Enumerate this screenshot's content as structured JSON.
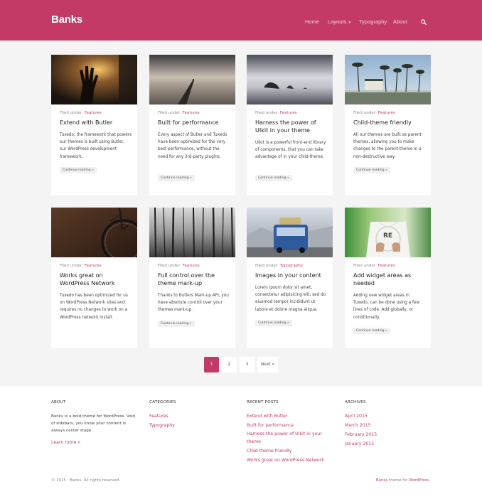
{
  "header": {
    "logo": "Banks",
    "nav": {
      "home": "Home",
      "layouts": "Layouts",
      "typography": "Typography",
      "about": "About"
    },
    "search_icon": "search-icon"
  },
  "colors": {
    "brand": "#c23a65",
    "page_bg": "#f4f4f4"
  },
  "filed_label": "Filed under:",
  "continue_label": "Continue reading »",
  "posts": [
    {
      "category": "Features",
      "title": "Extend with Butler",
      "excerpt": "Tuxedo, the framework that powers our themes is built using Butler, our WordPress development framework."
    },
    {
      "category": "Features",
      "title": "Built for performance",
      "excerpt": "Every aspect of Butler and Tuxedo have been optimized for the very best performance, without the need for any 3rd-party plugins."
    },
    {
      "category": "Features",
      "title": "Harness the power of UIkit in your theme",
      "excerpt": "UIkit is a powerful front-end library of components, that you can take advantage of in your child-theme."
    },
    {
      "category": "Features",
      "title": "Child-theme friendly",
      "excerpt": "All our themes are built as parent-themes, allowing you to make changes to the parent-theme in a non-destructive way."
    },
    {
      "category": "Features",
      "title": "Works great on WordPress Network",
      "excerpt": "Tuxedo has been optimized for us on WordPress Network sites and requires no changes to work on a WordPress network install."
    },
    {
      "category": "Features",
      "title": "Full control over the theme mark-up",
      "excerpt": "Thanks to Butlers Mark-up API, you have absolute control over your themes mark-up."
    },
    {
      "category": "Typography",
      "title": "Images in your content",
      "excerpt": "Lorem ipsum dolor sit amet, consectetur adipisicing elit, sed do eiusmod tempor incididunt ut labore et dolore magna aliqua."
    },
    {
      "category": "Features",
      "title": "Add widget areas as needed",
      "excerpt": "Adding new widget areas in Tuxedo, can be done using a few lines of code. Add globally, or conditionally."
    }
  ],
  "pagination": {
    "current": "1",
    "pages": [
      "1",
      "2",
      "3"
    ],
    "next": "Next »"
  },
  "footer": {
    "about": {
      "heading": "ABOUT",
      "text": "Banks is a bold theme for WordPress. Void of sidebars, you know your content is always center stage.",
      "link": "Learn more »"
    },
    "categories": {
      "heading": "CATEGORIES",
      "items": [
        "Features",
        "Typography"
      ]
    },
    "recent": {
      "heading": "RECENT POSTS",
      "items": [
        "Extend with Butler",
        "Built for performance",
        "Harness the power of UIkit in your theme",
        "Child-theme friendly",
        "Works great on WordPress Network"
      ]
    },
    "archives": {
      "heading": "ARCHIVES",
      "items": [
        "April 2015",
        "March 2015",
        "February 2015",
        "January 2015"
      ]
    },
    "copyright": "© 2015 - Banks. All rights reserved.",
    "credit": {
      "theme": "Banks",
      "mid": " theme for ",
      "platform": "WordPress."
    }
  }
}
